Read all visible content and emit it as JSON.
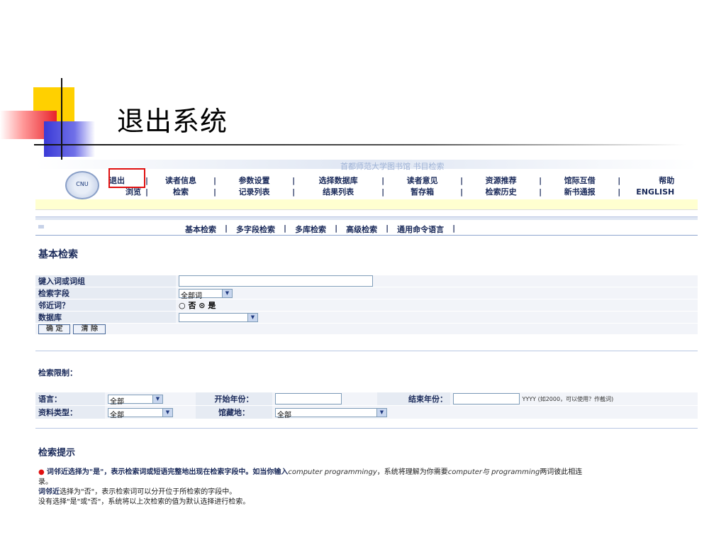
{
  "slide": {
    "title": "退出系统"
  },
  "app": {
    "logo_text": "CNU",
    "banner_faint": "首都师范大学图书馆 书目检索",
    "nav_row1": [
      "退出",
      "读者信息",
      "参数设置",
      "选择数据库",
      "读者意见",
      "资源推荐",
      "馆际互借",
      "帮助"
    ],
    "nav_row2": [
      "浏览",
      "检索",
      "记录列表",
      "结果列表",
      "暂存箱",
      "检索历史",
      "新书通报",
      "ENGLISH"
    ],
    "subnav": [
      "基本检索",
      "多字段检索",
      "多库检索",
      "高级检索",
      "通用命令语言"
    ]
  },
  "basic": {
    "heading": "基本检索",
    "rows": {
      "term_label": "键入词或词组",
      "field_label": "检索字段",
      "field_value": "全部词",
      "adjacent_label": "邻近词？",
      "adjacent_no": "否",
      "adjacent_yes": "是",
      "db_label": "数据库",
      "db_value": ""
    },
    "ok_button": "确 定",
    "clear_button": "清 除"
  },
  "limits": {
    "title": "检索限制：",
    "lang_label": "语言：",
    "lang_value": "全部",
    "start_label": "开始年份：",
    "end_label": "结束年份：",
    "year_hint": "YYYY (如2000，可以使用？作截词)",
    "type_label": "资料类型：",
    "type_value": "全部",
    "loc_label": "馆藏地：",
    "loc_value": "全部"
  },
  "tips": {
    "title": "检索提示",
    "line1_a": "词邻近选择为\"是\"，表示检索词或短语完整地出现在检索字段中。如当你输入",
    "line1_i1": "computer programmingy",
    "line1_b": "，系统将理解为你需要",
    "line1_i2": "computer与 programming",
    "line1_c": "两词彼此相连",
    "line1_d": "录。",
    "line2_b": "词邻近",
    "line2": "选择为\"否\"，表示检索词可以分开位于所检索的字段中。",
    "line3": "没有选择\"是\"或\"否\"，系统将以上次检索的值为默认选择进行检索。"
  }
}
